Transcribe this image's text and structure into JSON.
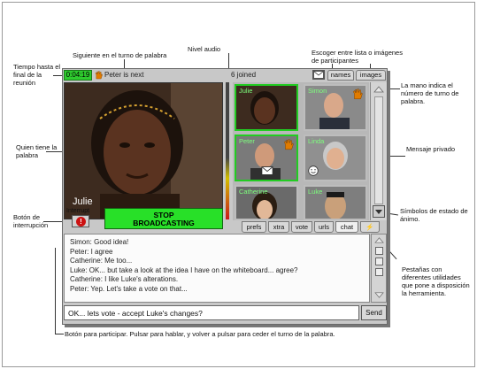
{
  "annotations": {
    "time_to_end": "Tiempo hasta el final de la reunión",
    "next_turn": "Siguiente en el turno de palabra",
    "audio_level": "Nivel audio",
    "choose_list": "Escoger entre lista o imágenes de participantes",
    "hand_indicates": "La mano indica el número de turno de palabra.",
    "speaker_holder": "Quien tiene la palabra",
    "private_message": "Mensaje privado",
    "interrupt_button": "Botón de interrupción",
    "mood_symbols": "Símbolos de estado de ánimo.",
    "tabs_tools": "Pestañas con diferentes utilidades que pone a disposición la herramienta.",
    "participate_button": "Botón para participar. Pulsar para hablar, y volver a pulsar para ceder el turno de la palabra."
  },
  "status": {
    "timer": "0:04:19",
    "next_speaker": "Peter is next",
    "joined": "6 joined"
  },
  "top_tabs": [
    "names",
    "images"
  ],
  "speaker": {
    "name": "Julie"
  },
  "controls": {
    "interrupt_label": "Interrupt",
    "interrupt_symbol": "!",
    "stop_line1": "STOP",
    "stop_line2": "BROADCASTING"
  },
  "participants": [
    {
      "name": "Julie",
      "active": true
    },
    {
      "name": "Simon",
      "hand": true
    },
    {
      "name": "Peter",
      "hand": true,
      "private_message": true,
      "active": true
    },
    {
      "name": "Linda",
      "mood": true
    },
    {
      "name": "Catherine"
    },
    {
      "name": "Luke"
    }
  ],
  "bottom_tabs": [
    "prefs",
    "xtra",
    "vote",
    "urls",
    "chat",
    "⚡"
  ],
  "chat": {
    "lines": [
      "Simon: Good idea!",
      "Peter: I agree",
      "Catherine: Me too...",
      "Luke: OK... but take a look at the idea I have on the whiteboard... agree?",
      "Catherine: I like Luke's alterations.",
      "Peter: Yep. Let's take a vote on that..."
    ],
    "input_value": "OK... lets vote - accept Luke's changes?",
    "send_label": "Send"
  },
  "colors": {
    "active_green": "#28e028",
    "hand_orange": "#e07b00",
    "interrupt_red": "#cc1111"
  }
}
